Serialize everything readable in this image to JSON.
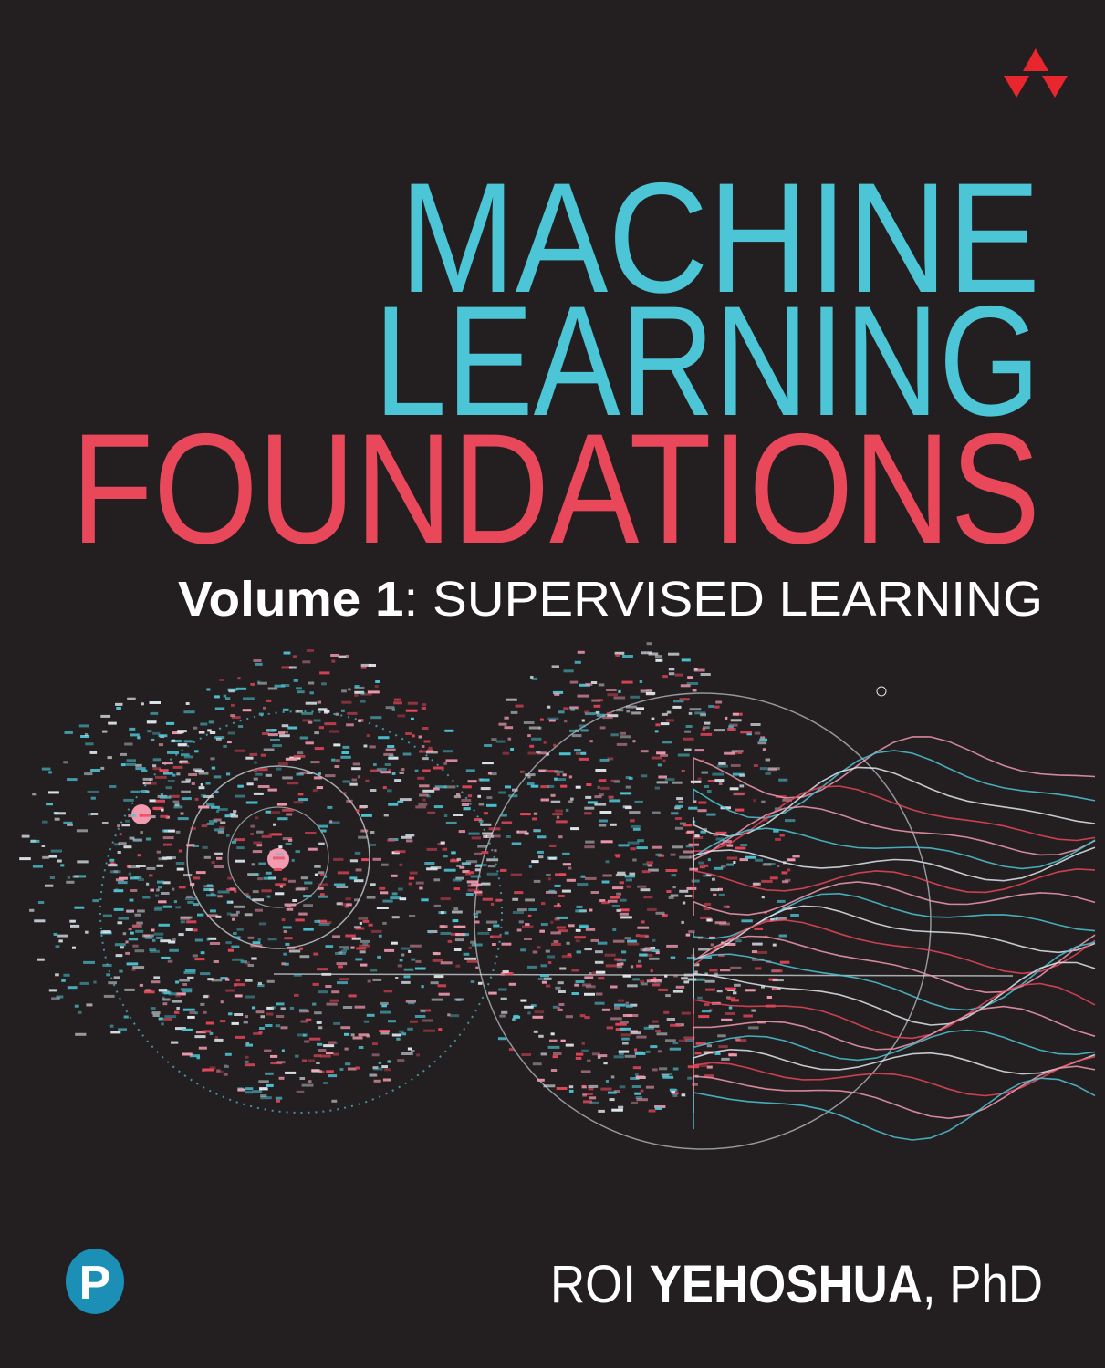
{
  "cover": {
    "title_line1": "MACHINE",
    "title_line2": "LEARNING",
    "title_line3": "FOUNDATIONS",
    "volume_label": "Volume 1",
    "volume_sep": ":",
    "subtitle": " SUPERVISED LEARNING",
    "author_first": "ROI ",
    "author_last": "YEHOSHUA",
    "author_suffix": ", PhD",
    "publisher_logo_letter": "P"
  },
  "colors": {
    "background": "#231f20",
    "cyan": "#4cc6d6",
    "red": "#e9475a",
    "white": "#ffffff",
    "logo_red": "#e8262d",
    "pearson_blue": "#1b8fb5"
  }
}
